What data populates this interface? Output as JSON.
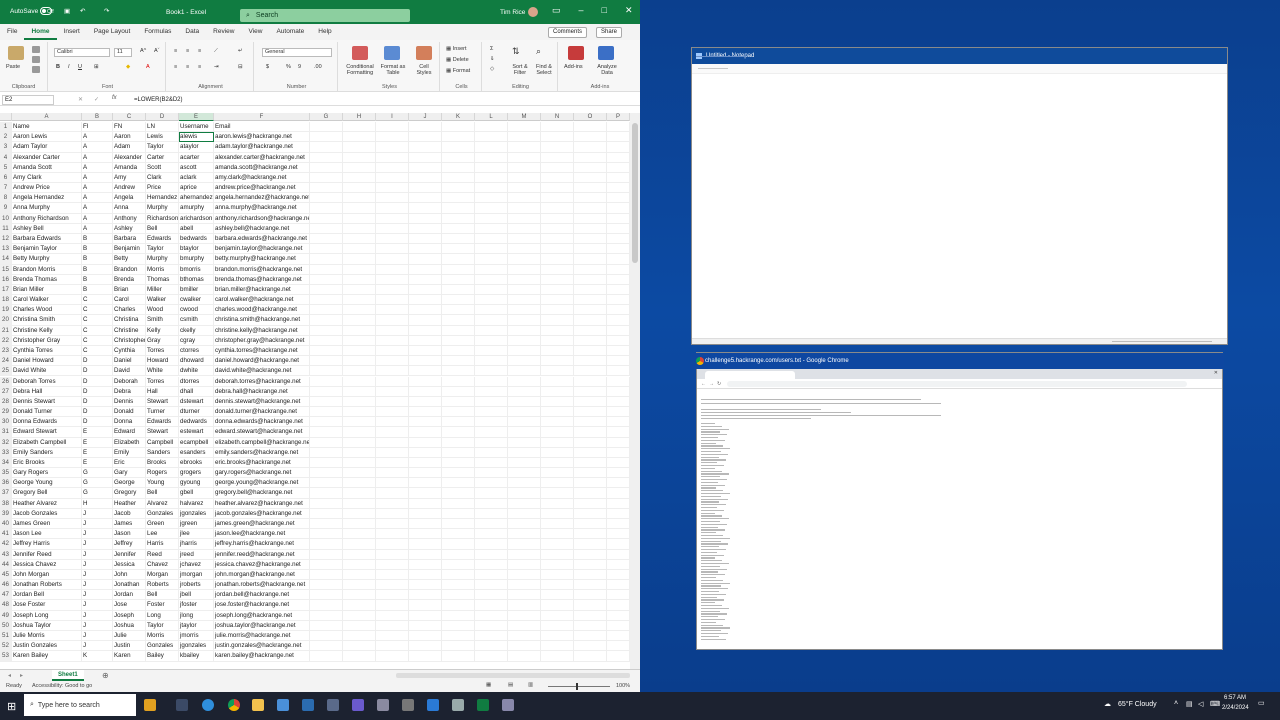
{
  "excel": {
    "autosave_label": "AutoSave",
    "autosave_state": "Off",
    "book_title": "Book1 - Excel",
    "search_placeholder": "Search",
    "user_name": "Tim Rice",
    "tabs": [
      "File",
      "Home",
      "Insert",
      "Page Layout",
      "Formulas",
      "Data",
      "Review",
      "View",
      "Automate",
      "Help"
    ],
    "active_tab": "Home",
    "comments_label": "Comments",
    "share_label": "Share",
    "ribbon": {
      "clipboard": {
        "paste": "Paste",
        "label": "Clipboard"
      },
      "font": {
        "name": "Calibri",
        "size": "11",
        "label": "Font"
      },
      "alignment": {
        "label": "Alignment"
      },
      "number": {
        "format": "General",
        "label": "Number"
      },
      "styles": {
        "conditional": "Conditional Formatting",
        "format_table": "Format as Table",
        "cell_styles": "Cell Styles",
        "label": "Styles"
      },
      "cells": {
        "insert": "Insert",
        "delete": "Delete",
        "format": "Format",
        "label": "Cells"
      },
      "editing": {
        "sort": "Sort & Filter",
        "find": "Find & Select",
        "label": "Editing"
      },
      "addins": {
        "addins": "Add-ins",
        "analyze": "Analyze Data",
        "label": "Add-ins"
      }
    },
    "name_box": "E2",
    "formula": "=LOWER(B2&D2)",
    "columns": [
      "A",
      "B",
      "C",
      "D",
      "E",
      "F",
      "G",
      "H",
      "I",
      "J",
      "K",
      "L",
      "M",
      "N",
      "O",
      "P"
    ],
    "rows": [
      [
        "Name",
        "FI",
        "FN",
        "LN",
        "Username",
        "Email"
      ],
      [
        "Aaron Lewis",
        "A",
        "Aaron",
        "Lewis",
        "alewis",
        "aaron.lewis@hackrange.net"
      ],
      [
        "Adam Taylor",
        "A",
        "Adam",
        "Taylor",
        "ataylor",
        "adam.taylor@hackrange.net"
      ],
      [
        "Alexander Carter",
        "A",
        "Alexander",
        "Carter",
        "acarter",
        "alexander.carter@hackrange.net"
      ],
      [
        "Amanda Scott",
        "A",
        "Amanda",
        "Scott",
        "ascott",
        "amanda.scott@hackrange.net"
      ],
      [
        "Amy Clark",
        "A",
        "Amy",
        "Clark",
        "aclark",
        "amy.clark@hackrange.net"
      ],
      [
        "Andrew Price",
        "A",
        "Andrew",
        "Price",
        "aprice",
        "andrew.price@hackrange.net"
      ],
      [
        "Angela Hernandez",
        "A",
        "Angela",
        "Hernandez",
        "ahernandez",
        "angela.hernandez@hackrange.net"
      ],
      [
        "Anna Murphy",
        "A",
        "Anna",
        "Murphy",
        "amurphy",
        "anna.murphy@hackrange.net"
      ],
      [
        "Anthony Richardson",
        "A",
        "Anthony",
        "Richardson",
        "arichardson",
        "anthony.richardson@hackrange.net"
      ],
      [
        "Ashley Bell",
        "A",
        "Ashley",
        "Bell",
        "abell",
        "ashley.bell@hackrange.net"
      ],
      [
        "Barbara Edwards",
        "B",
        "Barbara",
        "Edwards",
        "bedwards",
        "barbara.edwards@hackrange.net"
      ],
      [
        "Benjamin Taylor",
        "B",
        "Benjamin",
        "Taylor",
        "btaylor",
        "benjamin.taylor@hackrange.net"
      ],
      [
        "Betty Murphy",
        "B",
        "Betty",
        "Murphy",
        "bmurphy",
        "betty.murphy@hackrange.net"
      ],
      [
        "Brandon Morris",
        "B",
        "Brandon",
        "Morris",
        "bmorris",
        "brandon.morris@hackrange.net"
      ],
      [
        "Brenda Thomas",
        "B",
        "Brenda",
        "Thomas",
        "bthomas",
        "brenda.thomas@hackrange.net"
      ],
      [
        "Brian Miller",
        "B",
        "Brian",
        "Miller",
        "bmiller",
        "brian.miller@hackrange.net"
      ],
      [
        "Carol Walker",
        "C",
        "Carol",
        "Walker",
        "cwalker",
        "carol.walker@hackrange.net"
      ],
      [
        "Charles Wood",
        "C",
        "Charles",
        "Wood",
        "cwood",
        "charles.wood@hackrange.net"
      ],
      [
        "Christina Smith",
        "C",
        "Christina",
        "Smith",
        "csmith",
        "christina.smith@hackrange.net"
      ],
      [
        "Christine Kelly",
        "C",
        "Christine",
        "Kelly",
        "ckelly",
        "christine.kelly@hackrange.net"
      ],
      [
        "Christopher Gray",
        "C",
        "Christopher",
        "Gray",
        "cgray",
        "christopher.gray@hackrange.net"
      ],
      [
        "Cynthia Torres",
        "C",
        "Cynthia",
        "Torres",
        "ctorres",
        "cynthia.torres@hackrange.net"
      ],
      [
        "Daniel Howard",
        "D",
        "Daniel",
        "Howard",
        "dhoward",
        "daniel.howard@hackrange.net"
      ],
      [
        "David White",
        "D",
        "David",
        "White",
        "dwhite",
        "david.white@hackrange.net"
      ],
      [
        "Deborah Torres",
        "D",
        "Deborah",
        "Torres",
        "dtorres",
        "deborah.torres@hackrange.net"
      ],
      [
        "Debra Hall",
        "D",
        "Debra",
        "Hall",
        "dhall",
        "debra.hall@hackrange.net"
      ],
      [
        "Dennis Stewart",
        "D",
        "Dennis",
        "Stewart",
        "dstewart",
        "dennis.stewart@hackrange.net"
      ],
      [
        "Donald Turner",
        "D",
        "Donald",
        "Turner",
        "dturner",
        "donald.turner@hackrange.net"
      ],
      [
        "Donna Edwards",
        "D",
        "Donna",
        "Edwards",
        "dedwards",
        "donna.edwards@hackrange.net"
      ],
      [
        "Edward Stewart",
        "E",
        "Edward",
        "Stewart",
        "estewart",
        "edward.stewart@hackrange.net"
      ],
      [
        "Elizabeth Campbell",
        "E",
        "Elizabeth",
        "Campbell",
        "ecampbell",
        "elizabeth.campbell@hackrange.net"
      ],
      [
        "Emily Sanders",
        "E",
        "Emily",
        "Sanders",
        "esanders",
        "emily.sanders@hackrange.net"
      ],
      [
        "Eric Brooks",
        "E",
        "Eric",
        "Brooks",
        "ebrooks",
        "eric.brooks@hackrange.net"
      ],
      [
        "Gary Rogers",
        "G",
        "Gary",
        "Rogers",
        "grogers",
        "gary.rogers@hackrange.net"
      ],
      [
        "George Young",
        "G",
        "George",
        "Young",
        "gyoung",
        "george.young@hackrange.net"
      ],
      [
        "Gregory Bell",
        "G",
        "Gregory",
        "Bell",
        "gbell",
        "gregory.bell@hackrange.net"
      ],
      [
        "Heather Alvarez",
        "H",
        "Heather",
        "Alvarez",
        "halvarez",
        "heather.alvarez@hackrange.net"
      ],
      [
        "Jacob Gonzales",
        "J",
        "Jacob",
        "Gonzales",
        "jgonzales",
        "jacob.gonzales@hackrange.net"
      ],
      [
        "James Green",
        "J",
        "James",
        "Green",
        "jgreen",
        "james.green@hackrange.net"
      ],
      [
        "Jason Lee",
        "J",
        "Jason",
        "Lee",
        "jlee",
        "jason.lee@hackrange.net"
      ],
      [
        "Jeffrey Harris",
        "J",
        "Jeffrey",
        "Harris",
        "jharris",
        "jeffrey.harris@hackrange.net"
      ],
      [
        "Jennifer Reed",
        "J",
        "Jennifer",
        "Reed",
        "jreed",
        "jennifer.reed@hackrange.net"
      ],
      [
        "Jessica Chavez",
        "J",
        "Jessica",
        "Chavez",
        "jchavez",
        "jessica.chavez@hackrange.net"
      ],
      [
        "John Morgan",
        "J",
        "John",
        "Morgan",
        "jmorgan",
        "john.morgan@hackrange.net"
      ],
      [
        "Jonathan Roberts",
        "J",
        "Jonathan",
        "Roberts",
        "jroberts",
        "jonathan.roberts@hackrange.net"
      ],
      [
        "Jordan Bell",
        "J",
        "Jordan",
        "Bell",
        "jbell",
        "jordan.bell@hackrange.net"
      ],
      [
        "Jose Foster",
        "J",
        "Jose",
        "Foster",
        "jfoster",
        "jose.foster@hackrange.net"
      ],
      [
        "Joseph Long",
        "J",
        "Joseph",
        "Long",
        "jlong",
        "joseph.long@hackrange.net"
      ],
      [
        "Joshua Taylor",
        "J",
        "Joshua",
        "Taylor",
        "jtaylor",
        "joshua.taylor@hackrange.net"
      ],
      [
        "Julie Morris",
        "J",
        "Julie",
        "Morris",
        "jmorris",
        "julie.morris@hackrange.net"
      ],
      [
        "Justin Gonzales",
        "J",
        "Justin",
        "Gonzales",
        "jgonzales",
        "justin.gonzales@hackrange.net"
      ],
      [
        "Karen Bailey",
        "K",
        "Karen",
        "Bailey",
        "kbailey",
        "karen.bailey@hackrange.net"
      ]
    ],
    "sheet_tab": "Sheet1",
    "status_ready": "Ready",
    "status_accessibility": "Accessibility: Good to go",
    "zoom": "100%",
    "accent": "#107c41"
  },
  "notepad": {
    "title": "Untitled - Notepad"
  },
  "chrome": {
    "title": "challenge5.hackrange.com/users.txt - Google Chrome"
  },
  "taskbar": {
    "search_placeholder": "Type here to search",
    "weather": "65°F  Cloudy",
    "time": "6:57 AM",
    "date": "2/24/2024"
  }
}
